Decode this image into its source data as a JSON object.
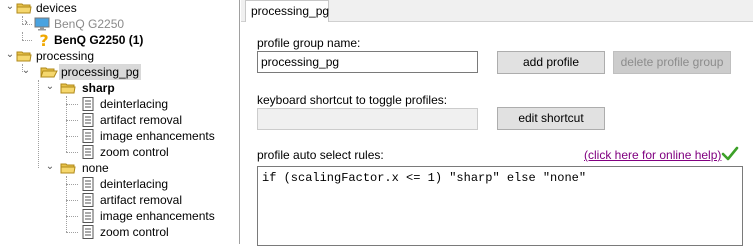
{
  "tree": {
    "devices": "devices",
    "device_gray": "BenQ G2250",
    "device_active": "BenQ G2250 (1)",
    "processing": "processing",
    "processing_pg": "processing_pg",
    "sharp": {
      "label": "sharp",
      "children": [
        "deinterlacing",
        "artifact removal",
        "image enhancements",
        "zoom control"
      ]
    },
    "none": {
      "label": "none",
      "children": [
        "deinterlacing",
        "artifact removal",
        "image enhancements",
        "zoom control"
      ]
    }
  },
  "tab": {
    "label": "processing_pg"
  },
  "form": {
    "group_name_label": "profile group name:",
    "group_name_value": "processing_pg",
    "add_profile": "add profile",
    "delete_profile_group": "delete profile group",
    "shortcut_label": "keyboard shortcut to toggle profiles:",
    "shortcut_value": "",
    "edit_shortcut": "edit shortcut",
    "rules_label": "profile auto select rules:",
    "help_link": "(click here for online help)",
    "rules_text": "if (scalingFactor.x <= 1) \"sharp\" else \"none\""
  },
  "colors": {
    "folder": "#f5d76e",
    "link": "#800080",
    "check": "#3ca028",
    "question": "#f0a800"
  }
}
